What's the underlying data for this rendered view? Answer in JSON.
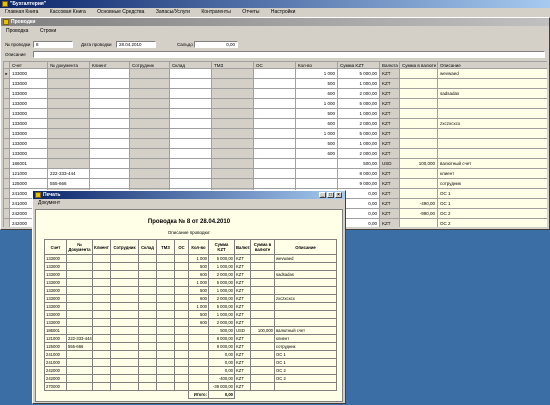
{
  "app": {
    "title": "\"Бухгалтерия\"",
    "menu": [
      "Главная Книга",
      "Кассовая Книга",
      "Основные Средства",
      "Запасы/Услуги",
      "Контрагенты",
      "Отчеты",
      "Настройки"
    ]
  },
  "main_window": {
    "title": "Проводки",
    "tabs": [
      "Проводка",
      "Строки"
    ],
    "number_label": "№ проводки",
    "number_value": "8",
    "date_label": "Дата проводки",
    "date_value": "28.04.2010",
    "balance_label": "Сальдо",
    "balance_value": "0,00",
    "description_label": "Описание",
    "description_value": "",
    "columns": [
      "Счет",
      "№ документа",
      "Клиент",
      "Сотрудник",
      "Склад",
      "ТМЗ",
      "ОС",
      "Кол-во",
      "Сумма KZT",
      "Валюта",
      "Сумма в валюте",
      "Описание"
    ],
    "rows": [
      [
        "133000",
        "",
        "",
        "",
        "",
        "",
        "",
        "1 000",
        "5 000,00",
        "KZT",
        "",
        "wevwaed"
      ],
      [
        "133000",
        "",
        "",
        "",
        "",
        "",
        "",
        "500",
        "1 000,00",
        "KZT",
        "",
        ""
      ],
      [
        "133000",
        "",
        "",
        "",
        "",
        "",
        "",
        "600",
        "2 000,00",
        "KZT",
        "",
        "sadsadas"
      ],
      [
        "133000",
        "",
        "",
        "",
        "",
        "",
        "",
        "1 000",
        "5 000,00",
        "KZT",
        "",
        ""
      ],
      [
        "133000",
        "",
        "",
        "",
        "",
        "",
        "",
        "500",
        "1 000,00",
        "KZT",
        "",
        ""
      ],
      [
        "133000",
        "",
        "",
        "",
        "",
        "",
        "",
        "600",
        "2 000,00",
        "KZT",
        "",
        "zxczxcxcx"
      ],
      [
        "133000",
        "",
        "",
        "",
        "",
        "",
        "",
        "1 000",
        "5 000,00",
        "KZT",
        "",
        ""
      ],
      [
        "133000",
        "",
        "",
        "",
        "",
        "",
        "",
        "500",
        "1 000,00",
        "KZT",
        "",
        ""
      ],
      [
        "133000",
        "",
        "",
        "",
        "",
        "",
        "",
        "600",
        "2 000,00",
        "KZT",
        "",
        ""
      ],
      [
        "186001",
        "",
        "",
        "",
        "",
        "",
        "",
        "",
        "500,00",
        "USD",
        "100,000",
        "валютный счет"
      ],
      [
        "121000",
        "222-333-444",
        "",
        "",
        "",
        "",
        "",
        "",
        "8 000,00",
        "KZT",
        "",
        "клиент"
      ],
      [
        "125000",
        "555-666",
        "",
        "",
        "",
        "",
        "",
        "",
        "9 000,00",
        "KZT",
        "",
        "сотрудник"
      ],
      [
        "241000",
        "",
        "",
        "",
        "",
        "",
        "",
        "",
        "0,00",
        "KZT",
        "",
        "ОС 1"
      ],
      [
        "241000",
        "",
        "",
        "",
        "",
        "",
        "",
        "",
        "0,00",
        "KZT",
        "-490,00",
        "ОС 1"
      ],
      [
        "242000",
        "",
        "",
        "",
        "",
        "",
        "",
        "",
        "0,00",
        "KZT",
        "-990,00",
        "ОС 2"
      ],
      [
        "242000",
        "",
        "",
        "",
        "",
        "",
        "",
        "",
        "0,00",
        "KZT",
        "",
        "ОС 2"
      ],
      [
        "270000",
        "",
        "",
        "",
        "",
        "",
        "",
        "",
        "-39 000,00",
        "KZT",
        "",
        ""
      ]
    ]
  },
  "print_window": {
    "title": "Печать",
    "menu": [
      "Документ"
    ],
    "report_title": "Проводка № 8 от 28.04.2010",
    "subtitle": "Описание проводки:",
    "columns": [
      "Счет",
      "№ Документа",
      "Клиент",
      "Сотрудник",
      "Склад",
      "ТМЗ",
      "ОС",
      "Кол-во",
      "Сумма KZT",
      "Валюта",
      "Сумма в валюте",
      "Описание"
    ],
    "rows": [
      [
        "133000",
        "",
        "",
        "",
        "",
        "",
        "",
        "1 000",
        "5 000,00",
        "KZT",
        "",
        "wevwaed"
      ],
      [
        "133000",
        "",
        "",
        "",
        "",
        "",
        "",
        "500",
        "1 000,00",
        "KZT",
        "",
        ""
      ],
      [
        "133000",
        "",
        "",
        "",
        "",
        "",
        "",
        "600",
        "2 000,00",
        "KZT",
        "",
        "sadsadas"
      ],
      [
        "133000",
        "",
        "",
        "",
        "",
        "",
        "",
        "1 000",
        "5 000,00",
        "KZT",
        "",
        ""
      ],
      [
        "133000",
        "",
        "",
        "",
        "",
        "",
        "",
        "500",
        "1 000,00",
        "KZT",
        "",
        ""
      ],
      [
        "133000",
        "",
        "",
        "",
        "",
        "",
        "",
        "600",
        "2 000,00",
        "KZT",
        "",
        "zxczxcxcx"
      ],
      [
        "133000",
        "",
        "",
        "",
        "",
        "",
        "",
        "1 000",
        "5 000,00",
        "KZT",
        "",
        ""
      ],
      [
        "133000",
        "",
        "",
        "",
        "",
        "",
        "",
        "500",
        "1 000,00",
        "KZT",
        "",
        ""
      ],
      [
        "133000",
        "",
        "",
        "",
        "",
        "",
        "",
        "600",
        "2 000,00",
        "KZT",
        "",
        ""
      ],
      [
        "186001",
        "",
        "",
        "",
        "",
        "",
        "",
        "",
        "500,00",
        "USD",
        "100,000",
        "валютный счет"
      ],
      [
        "121000",
        "222-333-444",
        "",
        "",
        "",
        "",
        "",
        "",
        "8 000,00",
        "KZT",
        "",
        "клиент"
      ],
      [
        "125000",
        "555-666",
        "",
        "",
        "",
        "",
        "",
        "",
        "9 000,00",
        "KZT",
        "",
        "сотрудник"
      ],
      [
        "241000",
        "",
        "",
        "",
        "",
        "",
        "",
        "",
        "0,00",
        "KZT",
        "",
        "ОС 1"
      ],
      [
        "241000",
        "",
        "",
        "",
        "",
        "",
        "",
        "",
        "0,00",
        "KZT",
        "",
        "ОС 1"
      ],
      [
        "242000",
        "",
        "",
        "",
        "",
        "",
        "",
        "",
        "0,00",
        "KZT",
        "",
        "ОС 2"
      ],
      [
        "242000",
        "",
        "",
        "",
        "",
        "",
        "",
        "",
        "-400,00",
        "KZT",
        "",
        "ОС 2"
      ],
      [
        "270000",
        "",
        "",
        "",
        "",
        "",
        "",
        "",
        "-39 000,00",
        "KZT",
        "",
        ""
      ]
    ],
    "total_label": "Итого:",
    "total_value": "0,00"
  },
  "colors": {
    "desktop": "#3a6ea5",
    "title_active": "#0a246a",
    "panel": "#d4d0c8",
    "cell_yellow": "#ffffe8"
  }
}
